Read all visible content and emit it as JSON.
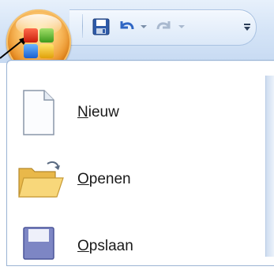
{
  "quick_access_toolbar": {
    "customize_icon": "customize-qat-icon"
  },
  "office_button": {
    "logo": "office-logo-icon"
  },
  "menu": {
    "items": [
      {
        "mnemonic": "N",
        "rest": "ieuw",
        "icon": "new-document-icon"
      },
      {
        "mnemonic": "O",
        "rest": "penen",
        "icon": "open-folder-icon"
      },
      {
        "mnemonic": "O",
        "rest": "pslaan",
        "icon": "save-icon"
      }
    ]
  },
  "colors": {
    "titlebar": "#d6e5f7",
    "office_button": "#e88a1d",
    "menu_border": "#9ab3d3"
  }
}
